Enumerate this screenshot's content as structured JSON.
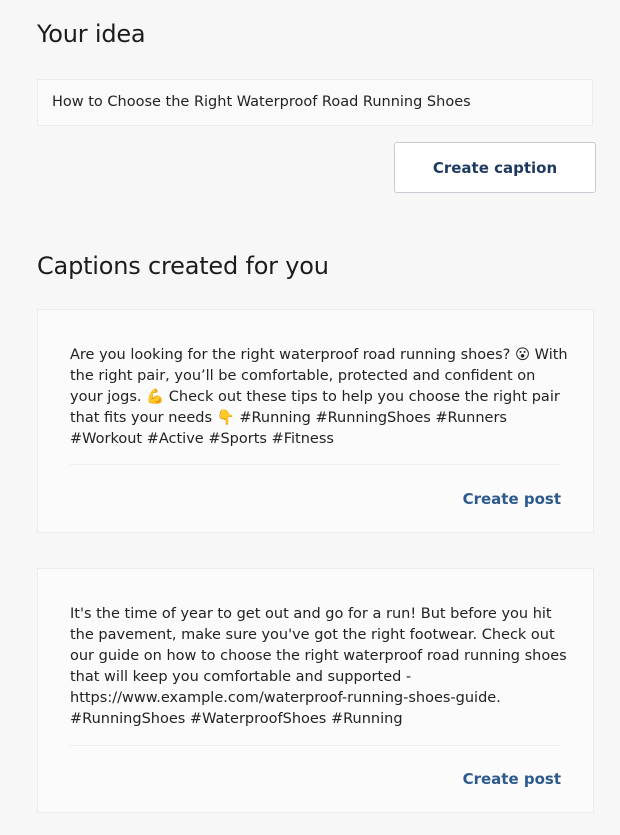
{
  "idea": {
    "heading": "Your idea",
    "value": "How to Choose the Right Waterproof Road Running Shoes",
    "button_label": "Create caption"
  },
  "captions": {
    "heading": "Captions created for you",
    "items": [
      {
        "text": "Are you looking for the right waterproof road running shoes? 😮 With the right pair, you’ll be comfortable, protected and confident on your jogs. 💪 Check out these tips to help you choose the right pair that fits your needs 👇 #Running #RunningShoes #Runners #Workout #Active #Sports #Fitness",
        "action_label": "Create post"
      },
      {
        "text": "It's the time of year to get out and go for a run! But before you hit the pavement, make sure you've got the right footwear. Check out our guide on how to choose the right waterproof road running shoes that will keep you comfortable and supported - https://www.example.com/waterproof-running-shoes-guide. #RunningShoes #WaterproofShoes #Running",
        "action_label": "Create post"
      }
    ]
  },
  "colors": {
    "background": "#f7f7f7",
    "card_background": "#fbfbfb",
    "button_text": "#1e3a5f",
    "link_text": "#2c5a8c"
  }
}
